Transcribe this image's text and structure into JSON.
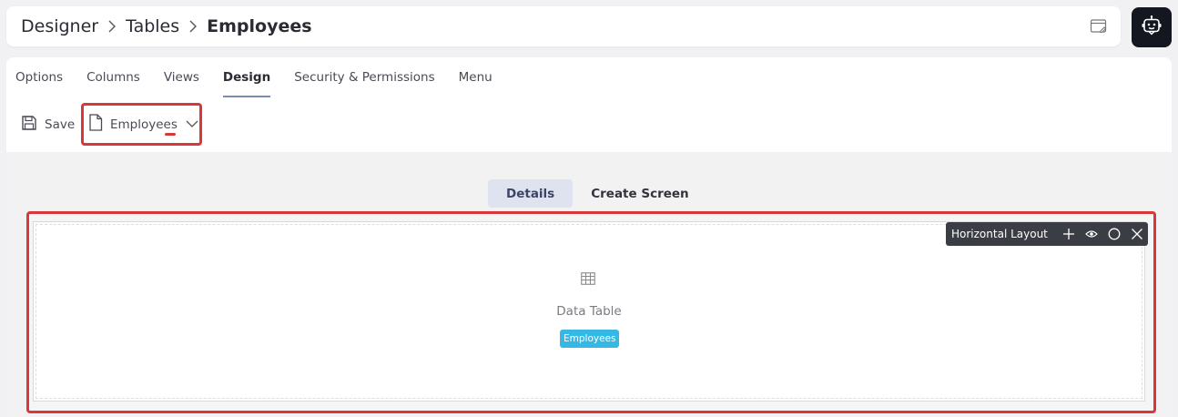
{
  "breadcrumb": {
    "items": [
      "Designer",
      "Tables"
    ],
    "current": "Employees"
  },
  "tabs": [
    "Options",
    "Columns",
    "Views",
    "Design",
    "Security & Permissions",
    "Menu"
  ],
  "active_tab": "Design",
  "toolbar": {
    "save_label": "Save",
    "selected_file": "Employees"
  },
  "subtabs": [
    "Details",
    "Create Screen"
  ],
  "active_subtab": "Details",
  "layout": {
    "toolbar_title": "Horizontal Layout",
    "component_label": "Data Table",
    "component_badge": "Employees"
  },
  "icons": {
    "header_right": "window-edit-icon",
    "bot": "robot-icon",
    "save": "floppy-disk-icon",
    "file": "document-icon",
    "dropdown": "chevron-down-icon",
    "data_table": "table-grid-icon",
    "layout_actions": [
      "plus-icon",
      "eye-icon",
      "circle-icon",
      "close-icon"
    ]
  },
  "colors": {
    "highlight": "#d9383a",
    "badge": "#35b8e4",
    "bot_button": "#14171f",
    "active_subtab_bg": "#dfe3ef",
    "layout_toolbar_bg": "#3a3d44"
  }
}
